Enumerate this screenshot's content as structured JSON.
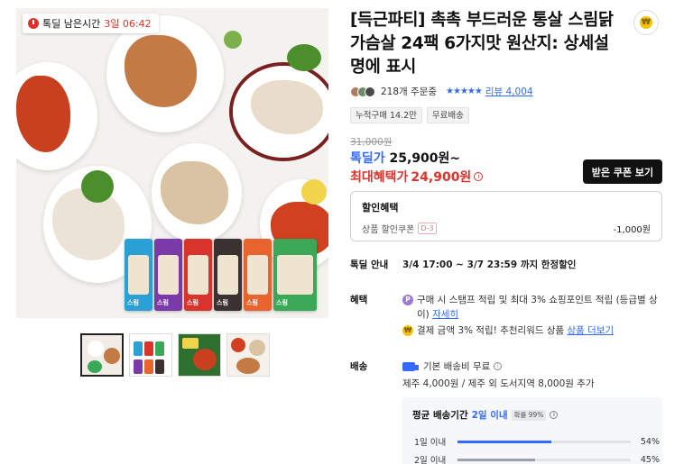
{
  "gallery": {
    "timer_label": "톡딜 남은시간",
    "timer_value": "3일 06:42",
    "thumbnails": [
      "thumb-1",
      "thumb-2",
      "thumb-3",
      "thumb-4"
    ]
  },
  "product": {
    "title": "[득근파티] 촉촉 부드러운 통살 스림닭가슴살 24팩 6가지맛 원산지: 상세설명에 표시",
    "orders": "218개 주문중",
    "stars": "★★★★★",
    "review_link": "리뷰 4,004",
    "tags": [
      "누적구매 14.2만",
      "무료배송"
    ]
  },
  "price": {
    "original": "31,000원",
    "deal_label": "톡딜가",
    "deal_value": "25,900원~",
    "max_label": "최대혜택가",
    "max_value": "24,900원",
    "coupon_button": "받은 쿠폰 보기"
  },
  "discount": {
    "header": "할인혜택",
    "item_label": "상품 할인쿠폰",
    "item_badge": "D-3",
    "item_amount": "-1,000원"
  },
  "deal_info": {
    "key": "톡딜 안내",
    "value": "3/4 17:00 ~ 3/7 23:59 까지 한정할인"
  },
  "benefit": {
    "key": "혜택",
    "line1": "구매 시 스탬프 적립 및 최대 3% 쇼핑포인트 적립 (등급별 상이)",
    "line1_link": "자세히",
    "line2": "결제 금액 3% 적립! 추천리워드 상품",
    "line2_link": "상품 더보기"
  },
  "shipping": {
    "key": "배송",
    "fee": "기본 배송비 무료",
    "extra": "제주 4,000원 / 제주 외 도서지역 8,000원 추가",
    "avg_label": "평균 배송기간",
    "avg_value": "2일 이내",
    "prob": "확률 99%",
    "bars": [
      {
        "label": "1일 이내",
        "percent": 54,
        "display": "54%"
      },
      {
        "label": "2일 이내",
        "percent": 45,
        "display": "45%"
      }
    ]
  },
  "colors": {
    "accent_blue": "#346aff",
    "accent_red": "#e0312b"
  }
}
